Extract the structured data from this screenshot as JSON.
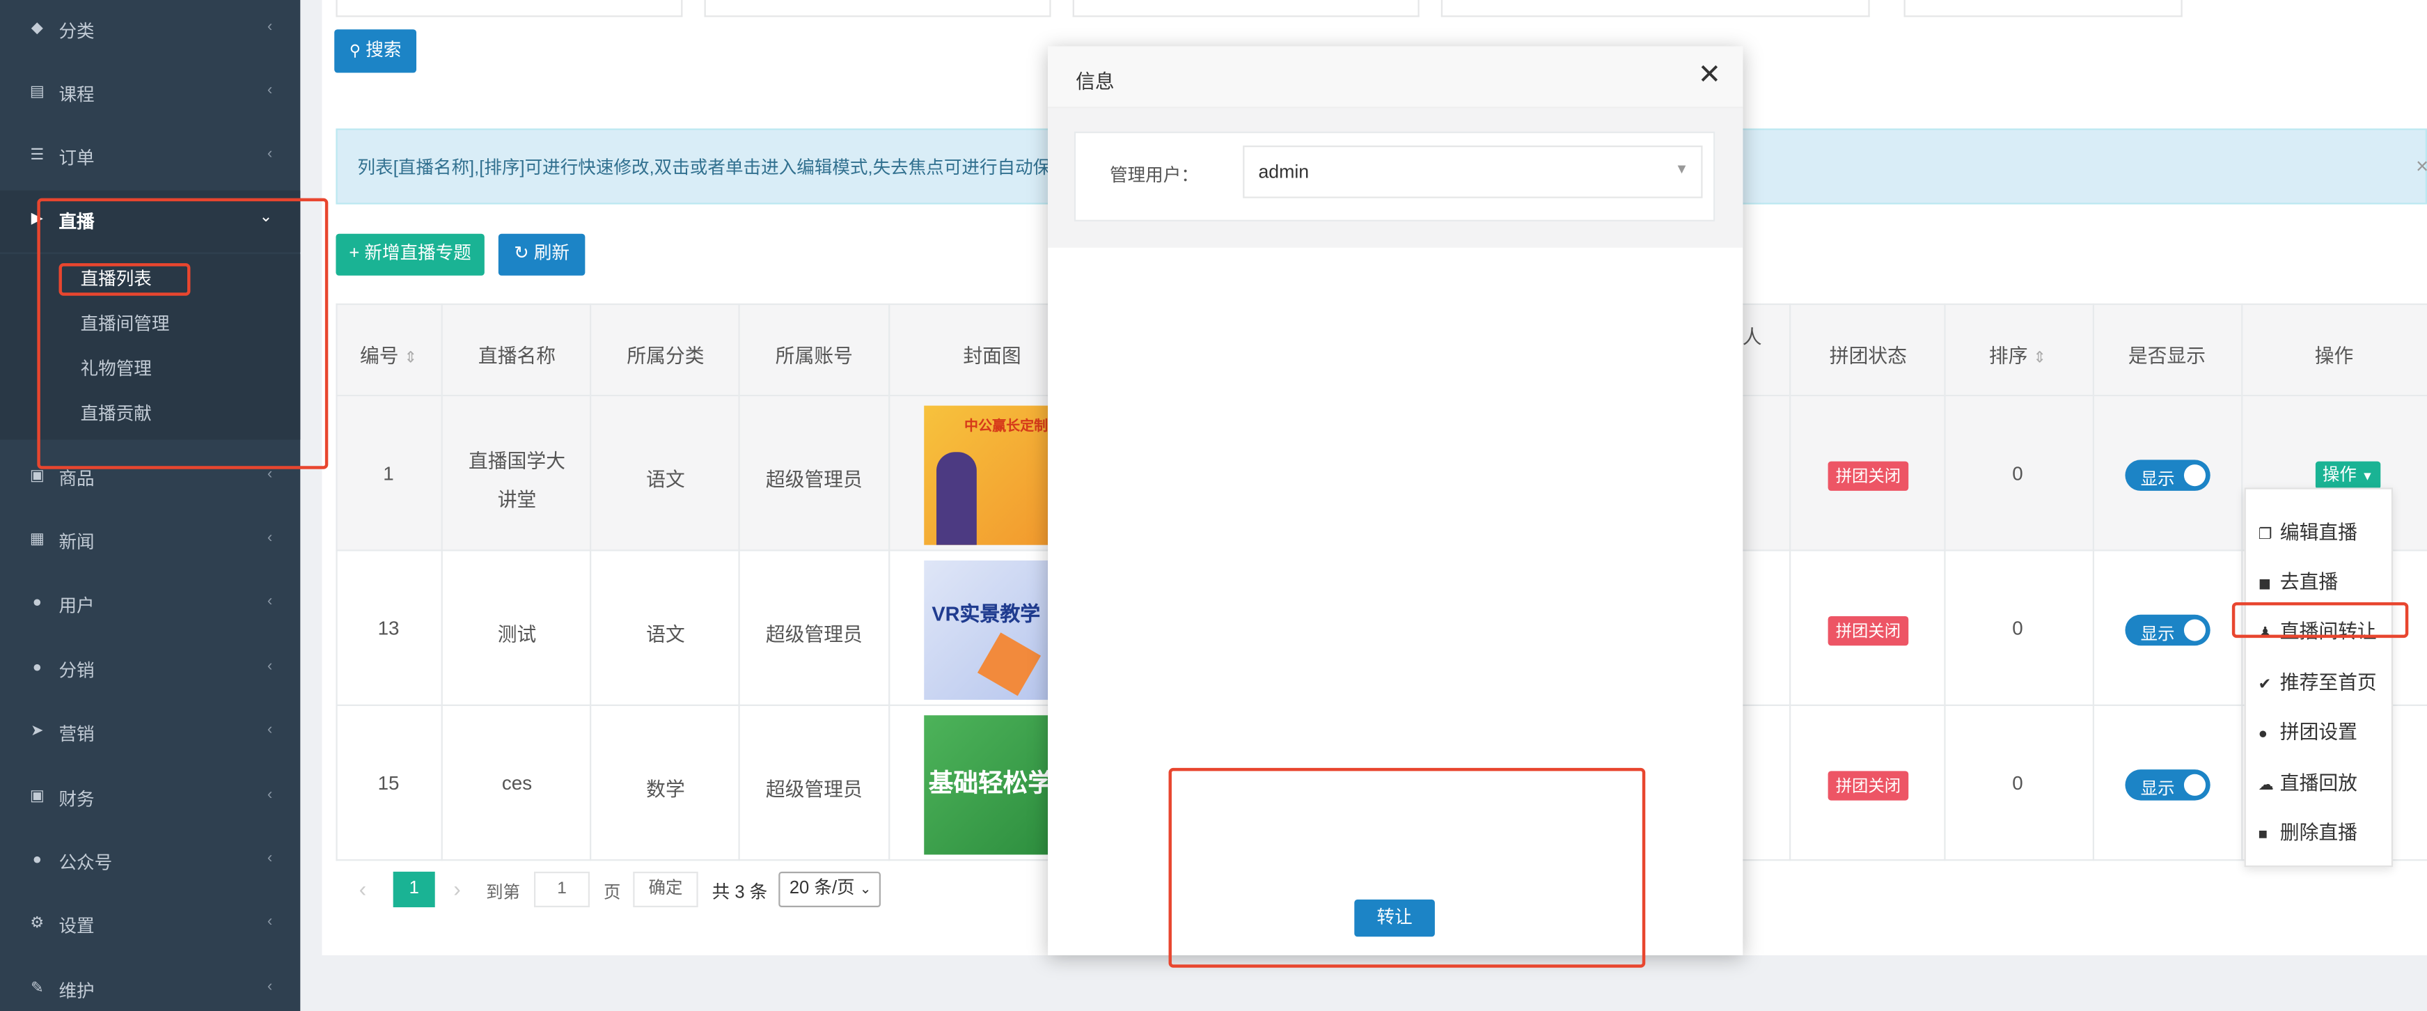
{
  "sidebar": {
    "items": [
      {
        "label": "分类",
        "icon": "tags-icon"
      },
      {
        "label": "课程",
        "icon": "book-icon"
      },
      {
        "label": "订单",
        "icon": "list-icon"
      },
      {
        "label": "直播",
        "icon": "video-icon"
      },
      {
        "label": "商品",
        "icon": "cart-icon"
      },
      {
        "label": "新闻",
        "icon": "image-icon"
      },
      {
        "label": "用户",
        "icon": "user-icon"
      },
      {
        "label": "分销",
        "icon": "users-icon"
      },
      {
        "label": "营销",
        "icon": "paper-plane-icon"
      },
      {
        "label": "财务",
        "icon": "money-icon"
      },
      {
        "label": "公众号",
        "icon": "wechat-icon"
      },
      {
        "label": "设置",
        "icon": "gear-icon"
      },
      {
        "label": "维护",
        "icon": "wrench-icon"
      }
    ],
    "sub_items": [
      "直播列表",
      "直播间管理",
      "礼物管理",
      "直播贡献"
    ]
  },
  "toolbar": {
    "search_label": "搜索",
    "add_label": "新增直播专题",
    "refresh_label": "刷新"
  },
  "alert": {
    "text": "列表[直播名称],[排序]可进行快速修改,双击或者单击进入编辑模式,失去焦点可进行自动保",
    "close": "×"
  },
  "table": {
    "headers": [
      "编号",
      "直播名称",
      "所属分类",
      "所属账号",
      "封面图",
      "人",
      "拼团状态",
      "排序",
      "是否显示",
      "操作"
    ],
    "rows": [
      {
        "id": "1",
        "name_line1": "直播国学大",
        "name_line2": "讲堂",
        "category": "语文",
        "account": "超级管理员",
        "group": "拼团关闭",
        "sort": "0",
        "show": "显示",
        "cover_text": "中公赢长定制 协议直播"
      },
      {
        "id": "13",
        "name_line1": "测试",
        "name_line2": "",
        "category": "语文",
        "account": "超级管理员",
        "group": "拼团关闭",
        "sort": "0",
        "show": "显示",
        "cover_text": "VR实景教学"
      },
      {
        "id": "15",
        "name_line1": "ces",
        "name_line2": "",
        "category": "数学",
        "account": "超级管理员",
        "group": "拼团关闭",
        "sort": "0",
        "show": "显示",
        "cover_text": "基础轻松学"
      }
    ],
    "op_button": "操作"
  },
  "pager": {
    "current": "1",
    "goto": "到第",
    "page_input": "1",
    "page_unit": "页",
    "confirm": "确定",
    "total": "共 3 条",
    "per_page": "20 条/页"
  },
  "dropdown": {
    "items": [
      {
        "label": "编辑直播",
        "icon": "copy-icon"
      },
      {
        "label": "去直播",
        "icon": "video-icon"
      },
      {
        "label": "直播间转让",
        "icon": "user-transfer-icon"
      },
      {
        "label": "推荐至首页",
        "icon": "check-circle-icon"
      },
      {
        "label": "拼团设置",
        "icon": "users-icon"
      },
      {
        "label": "直播回放",
        "icon": "cloud-download-icon"
      },
      {
        "label": "删除直播",
        "icon": "trash-icon"
      }
    ]
  },
  "modal": {
    "title": "信息",
    "field_label": "管理用户：",
    "select_value": "admin",
    "submit_label": "转让"
  },
  "colors": {
    "sidebar_bg": "#2f4050",
    "primary": "#1c84c6",
    "success": "#1ab394",
    "danger": "#ed5565",
    "highlight": "#e8462f"
  }
}
